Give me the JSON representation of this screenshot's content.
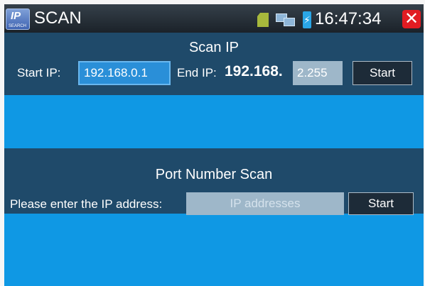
{
  "statusbar": {
    "logo_text": "IP",
    "logo_subtext": "SEARCH",
    "title": "SCAN",
    "time": "16:47:34",
    "close_glyph": "✕",
    "battery_glyph": "⚡",
    "icons": [
      "sd-card-icon",
      "network-icon",
      "battery-icon",
      "close-icon"
    ]
  },
  "scan_ip": {
    "title": "Scan IP",
    "start_label": "Start IP:",
    "start_value": "192.168.0.1",
    "end_label": "End IP:",
    "end_prefix": "192.168.",
    "end_value": "2.255",
    "button_label": "Start"
  },
  "port_scan": {
    "title": "Port Number Scan",
    "prompt": "Please enter the IP address:",
    "placeholder": "IP addresses",
    "button_label": "Start"
  },
  "colors": {
    "primary": "#0f98e4",
    "panel": "#1f4a6a",
    "close": "#e21c22"
  }
}
